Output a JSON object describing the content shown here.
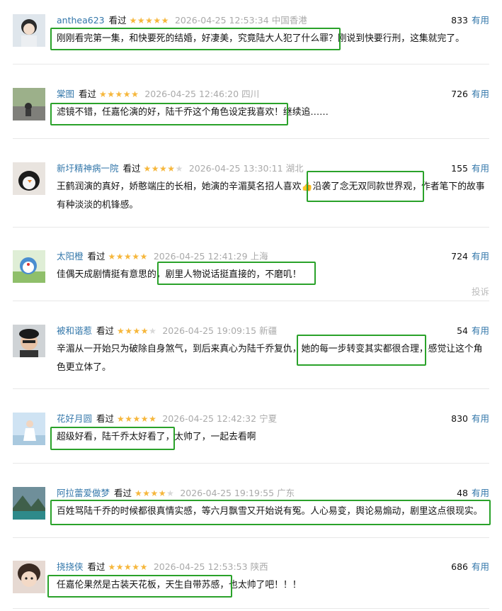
{
  "watched_label": "看过",
  "useful_label": "有用",
  "report_label": "投诉",
  "comments": [
    {
      "user": "anthea623",
      "stars": 5,
      "time": "2026-04-25 12:53:34",
      "location": "中国香港",
      "votes": "833",
      "text": "刚刚看完第一集，和快要死的结婚，好凄美，究竟陆大人犯了什么罪？刚说到快要行刑，这集就完了。"
    },
    {
      "user": "棠图",
      "stars": 5,
      "time": "2026-04-25 12:46:20",
      "location": "四川",
      "votes": "726",
      "text": "滤镜不错，任嘉伦演的好，陆千乔这个角色设定我喜欢！继续追……"
    },
    {
      "user": "新圩精神病一院",
      "stars": 4,
      "time": "2026-04-25 13:30:11",
      "location": "湖北",
      "votes": "155",
      "text": "王鹤润演的真好，娇憨端庄的长相，她演的辛湄莫名招人喜欢👍沿袭了念无双同款世界观，作者笔下的故事有种淡淡的机锋感。"
    },
    {
      "user": "太阳橙",
      "stars": 5,
      "time": "2026-04-25 12:41:29",
      "location": "上海",
      "votes": "724",
      "text": "佳偶天成剧情挺有意思的，剧里人物说话挺直接的，不磨叽！"
    },
    {
      "user": "被和谐惹",
      "stars": 4,
      "time": "2026-04-25 19:09:15",
      "location": "新疆",
      "votes": "54",
      "text": "辛湄从一开始只为破除自身煞气，到后来真心为陆千乔复仇，她的每一步转变其实都很合理，感觉让这个角色更立体了。"
    },
    {
      "user": "花好月圆",
      "stars": 5,
      "time": "2026-04-25 12:42:32",
      "location": "宁夏",
      "votes": "830",
      "text": "超级好看，陆千乔太好看了，太帅了，一起去看啊"
    },
    {
      "user": "阿拉蕾爱做梦",
      "stars": 4,
      "time": "2026-04-25 19:19:55",
      "location": "广东",
      "votes": "48",
      "text": "百姓骂陆千乔的时候都很真情实感，等六月飘雪又开始说有冤。人心易变，舆论易煽动，剧里这点很现实。"
    },
    {
      "user": "挠挠侠",
      "stars": 5,
      "time": "2026-04-25 12:53:53",
      "location": "陕西",
      "votes": "686",
      "text": "任嘉伦果然是古装天花板，天生自带苏感，也太帅了吧！！！"
    }
  ]
}
